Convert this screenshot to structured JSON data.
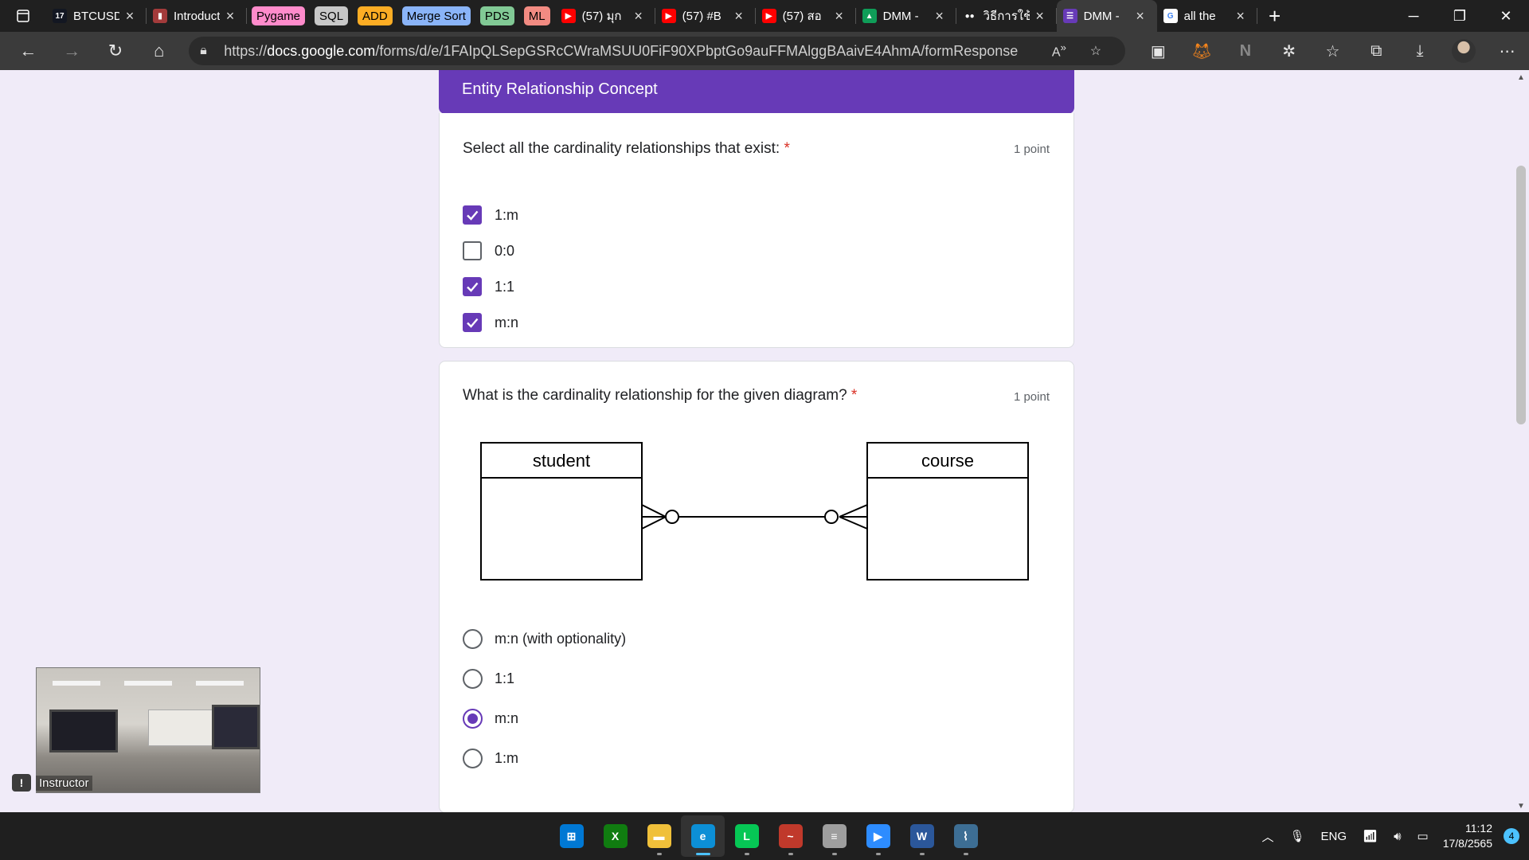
{
  "tabs": [
    {
      "title": "BTCUSD",
      "fav_text": "17",
      "fav_color": "#131722"
    },
    {
      "title": "Introduction",
      "fav_text": "▮",
      "fav_color": "#a33b3b"
    }
  ],
  "tab_groups": [
    {
      "label": "Pygame",
      "color": "#ff8bcb"
    },
    {
      "label": "SQL",
      "color": "#c8c8c8"
    },
    {
      "label": "ADD",
      "color": "#fcad24"
    },
    {
      "label": "Merge Sort",
      "color": "#8ab4f8"
    },
    {
      "label": "PDS",
      "color": "#81c995"
    },
    {
      "label": "ML",
      "color": "#f28b82"
    }
  ],
  "tabs_after": [
    {
      "title": "(57) มุก",
      "fav_text": "▶",
      "fav_color": "#ff0000"
    },
    {
      "title": "(57) #B",
      "fav_text": "▶",
      "fav_color": "#ff0000"
    },
    {
      "title": "(57) สอ",
      "fav_text": "▶",
      "fav_color": "#ff0000"
    },
    {
      "title": "DMM -",
      "fav_text": "▲",
      "fav_color": "#0f9d58"
    },
    {
      "title": "วิธีการใช้",
      "fav_text": "●●",
      "fav_color": "#202020"
    },
    {
      "title": "DMM -",
      "fav_text": "☰",
      "fav_color": "#673ab7",
      "active": true
    },
    {
      "title": "all the",
      "fav_text": "G",
      "fav_color": "#ffffff"
    }
  ],
  "address": {
    "url_prefix": "https://",
    "url_host": "docs.google.com",
    "url_path": "/forms/d/e/1FAIpQLSepGSRcCWraMSUU0FiF90XPbptGo9auFFMAlggBAaivE4AhmA/formResponse"
  },
  "form": {
    "section_title": "Entity Relationship Concept",
    "q1": {
      "title": "Select all the cardinality relationships that exist:",
      "required_mark": "*",
      "points": "1 point",
      "options": [
        {
          "label": "1:m",
          "checked": true
        },
        {
          "label": "0:0",
          "checked": false
        },
        {
          "label": "1:1",
          "checked": true
        },
        {
          "label": "m:n",
          "checked": true
        }
      ]
    },
    "q2": {
      "title": "What is the cardinality relationship for the given diagram?",
      "required_mark": "*",
      "points": "1 point",
      "diagram": {
        "left_entity": "student",
        "right_entity": "course"
      },
      "options": [
        {
          "label": "m:n (with optionality)",
          "selected": false
        },
        {
          "label": "1:1",
          "selected": false
        },
        {
          "label": "m:n",
          "selected": true
        },
        {
          "label": "1:m",
          "selected": false
        }
      ]
    }
  },
  "webcam": {
    "label": "Instructor"
  },
  "taskbar": {
    "apps": [
      {
        "name": "windows-start",
        "color": "#0078d4",
        "glyph": "⊞"
      },
      {
        "name": "xbox",
        "color": "#107c10",
        "glyph": "X"
      },
      {
        "name": "file-explorer",
        "color": "#f0c03a",
        "glyph": "▬"
      },
      {
        "name": "edge",
        "color": "#0c8fd6",
        "glyph": "e",
        "active": true
      },
      {
        "name": "line",
        "color": "#06c755",
        "glyph": "L"
      },
      {
        "name": "oracle",
        "color": "#c0392b",
        "glyph": "~"
      },
      {
        "name": "database",
        "color": "#9e9e9e",
        "glyph": "≡"
      },
      {
        "name": "zoom",
        "color": "#2d8cff",
        "glyph": "▶"
      },
      {
        "name": "word",
        "color": "#2b579a",
        "glyph": "W"
      },
      {
        "name": "mysql-workbench",
        "color": "#3d6e94",
        "glyph": "⌇"
      }
    ],
    "language": "ENG",
    "time": "11:12",
    "date": "17/8/2565",
    "notifications": "4"
  }
}
